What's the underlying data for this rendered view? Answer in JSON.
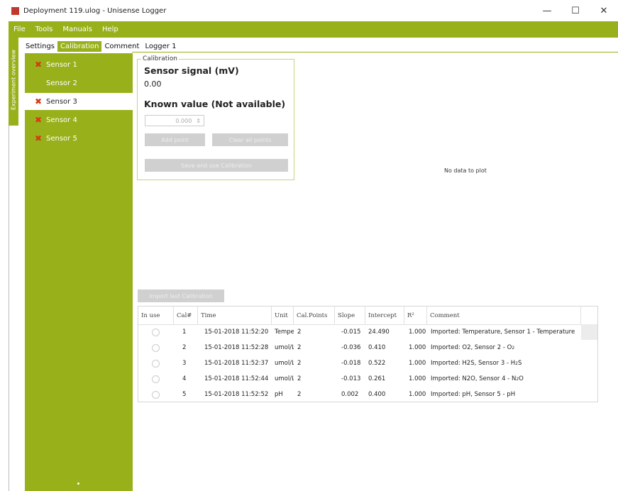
{
  "window": {
    "title": "Deployment 119.ulog - Unisense Logger",
    "controls": {
      "minimize": "—",
      "maximize": "☐",
      "close": "✕"
    }
  },
  "menu": [
    "File",
    "Tools",
    "Manuals",
    "Help"
  ],
  "side_tab": "Experiment overview",
  "tabs": [
    {
      "label": "Settings",
      "active": false
    },
    {
      "label": "Calibration",
      "active": true
    },
    {
      "label": "Comment",
      "active": false
    },
    {
      "label": "Logger 1",
      "active": false
    }
  ],
  "sensors": [
    {
      "label": "Sensor 1",
      "status": "error"
    },
    {
      "label": "Sensor 2",
      "status": "none"
    },
    {
      "label": "Sensor 3",
      "status": "error",
      "selected": true
    },
    {
      "label": "Sensor 4",
      "status": "error"
    },
    {
      "label": "Sensor 5",
      "status": "error"
    }
  ],
  "calibration": {
    "legend": "Calibration",
    "signal_title": "Sensor signal (mV)",
    "signal_value": "0.00",
    "known_title": "Known value (Not available)",
    "known_input": "0.000",
    "add_point": "Add point",
    "clear_points": "Clear all points",
    "save_calibration": "Save and use Calibration"
  },
  "plot": {
    "empty_text": "No data to plot"
  },
  "import_button": "Import last Calibration",
  "table": {
    "headers": [
      "In use",
      "Cal#",
      "Time",
      "Unit",
      "Cal.Points",
      "Slope",
      "Intercept",
      "R²",
      "Comment"
    ],
    "rows": [
      {
        "cal": "1",
        "time": "15-01-2018 11:52:20",
        "unit": "Tempe",
        "points": "2",
        "slope": "-0.015",
        "intercept": "24.490",
        "r2": "1.000",
        "comment": "Imported: Temperature, Sensor 1 - Temperature"
      },
      {
        "cal": "2",
        "time": "15-01-2018 11:52:28",
        "unit": "umol/L",
        "points": "2",
        "slope": "-0.036",
        "intercept": "0.410",
        "r2": "1.000",
        "comment": "Imported: O2, Sensor 2 - O",
        "sub": "2"
      },
      {
        "cal": "3",
        "time": "15-01-2018 11:52:37",
        "unit": "umol/L",
        "points": "2",
        "slope": "-0.018",
        "intercept": "0.522",
        "r2": "1.000",
        "comment": "Imported: H2S, Sensor 3 - H",
        "sub": "2",
        "tail": "S"
      },
      {
        "cal": "4",
        "time": "15-01-2018 11:52:44",
        "unit": "umol/L",
        "points": "2",
        "slope": "-0.013",
        "intercept": "0.261",
        "r2": "1.000",
        "comment": "Imported: N2O, Sensor 4 - N",
        "sub": "2",
        "tail": "O"
      },
      {
        "cal": "5",
        "time": "15-01-2018 11:52:52",
        "unit": "pH",
        "points": "2",
        "slope": "0.002",
        "intercept": "0.400",
        "r2": "1.000",
        "comment": "Imported: pH, Sensor 5 - pH"
      }
    ]
  },
  "colors": {
    "accent": "#98b11a",
    "error": "#d63a14",
    "disabled": "#d0d0d0"
  }
}
